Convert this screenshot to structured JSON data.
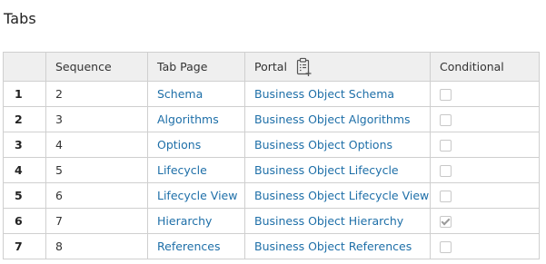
{
  "section": {
    "title": "Tabs"
  },
  "table": {
    "columns": {
      "sequence": "Sequence",
      "tab_page": "Tab Page",
      "portal": "Portal",
      "conditional": "Conditional"
    },
    "rows": [
      {
        "num": "1",
        "sequence": "2",
        "tab_page": "Schema",
        "portal": "Business Object Schema",
        "conditional": false
      },
      {
        "num": "2",
        "sequence": "3",
        "tab_page": "Algorithms",
        "portal": "Business Object Algorithms",
        "conditional": false
      },
      {
        "num": "3",
        "sequence": "4",
        "tab_page": "Options",
        "portal": "Business Object Options",
        "conditional": false
      },
      {
        "num": "4",
        "sequence": "5",
        "tab_page": "Lifecycle",
        "portal": "Business Object Lifecycle",
        "conditional": false
      },
      {
        "num": "5",
        "sequence": "6",
        "tab_page": "Lifecycle View",
        "portal": "Business Object Lifecycle View",
        "conditional": false
      },
      {
        "num": "6",
        "sequence": "7",
        "tab_page": "Hierarchy",
        "portal": "Business Object Hierarchy",
        "conditional": true
      },
      {
        "num": "7",
        "sequence": "8",
        "tab_page": "References",
        "portal": "Business Object References",
        "conditional": false
      }
    ]
  },
  "colors": {
    "link": "#1e6fa8",
    "header_bg": "#efefef",
    "border": "#cfcfcf"
  },
  "icons": {
    "portal_header": "clipboard-plus-icon"
  }
}
